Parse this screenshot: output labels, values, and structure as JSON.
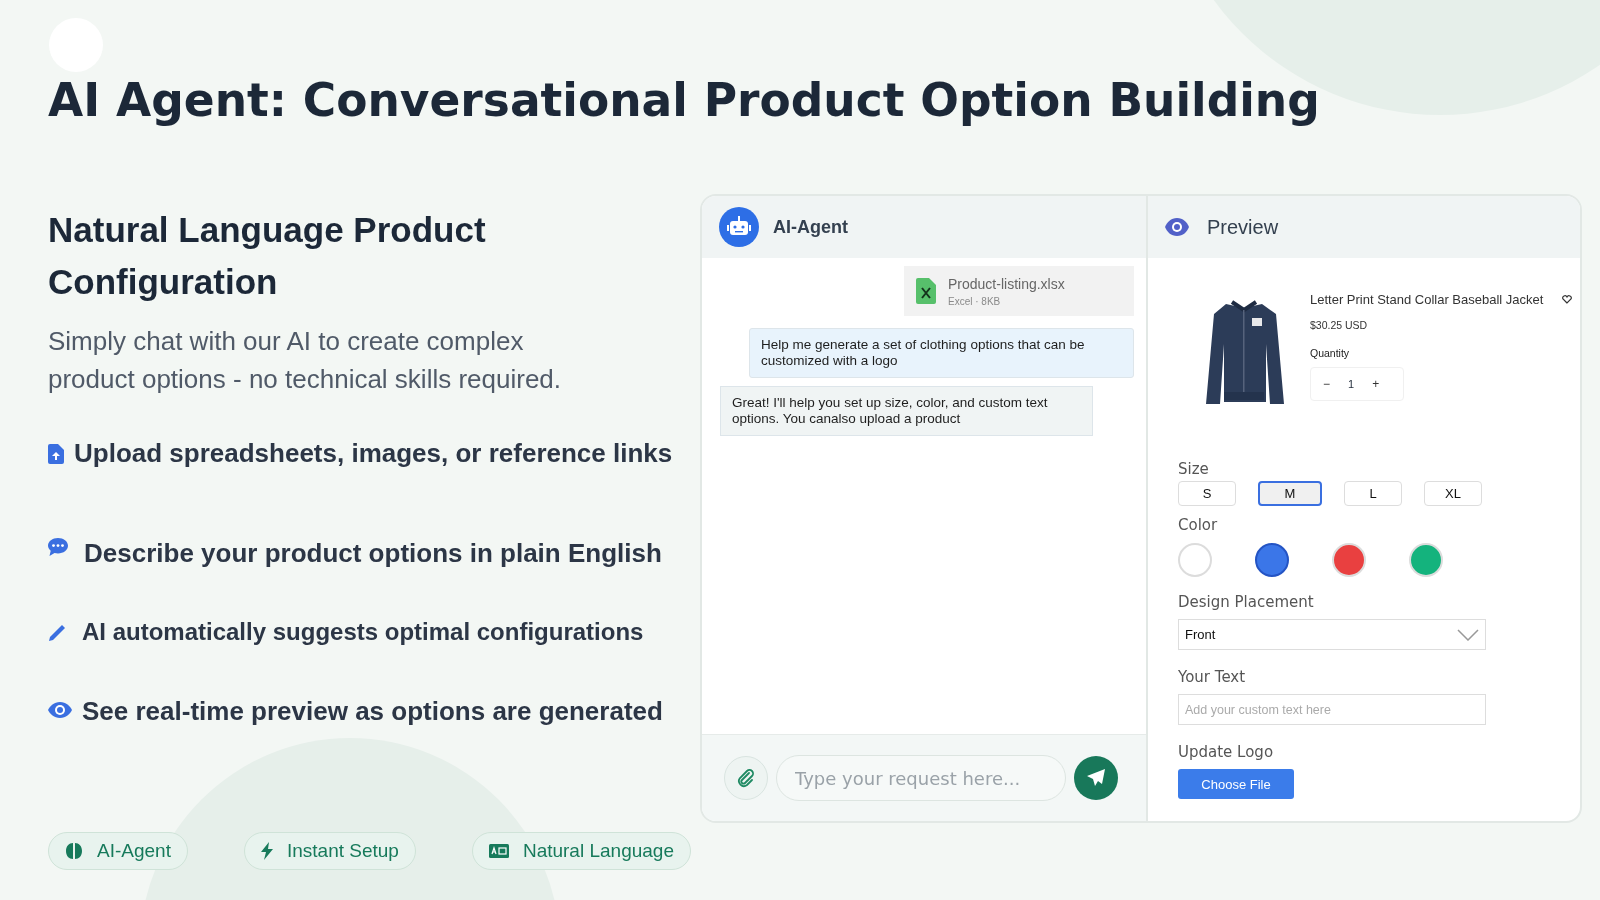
{
  "page": {
    "title": "AI Agent: Conversational Product Option Building"
  },
  "intro": {
    "heading": "Natural Language Product Configuration",
    "description": "Simply chat with our AI to create complex product options - no technical skills required."
  },
  "features": [
    {
      "kind": "upload",
      "text": "Upload spreadsheets, images, or reference links"
    },
    {
      "kind": "chat",
      "text": "Describe your product options in plain English"
    },
    {
      "kind": "pencil",
      "text": "AI automatically suggests optimal configurations"
    },
    {
      "kind": "eye",
      "text": "See real-time preview as options are generated"
    }
  ],
  "badges": [
    {
      "kind": "brain",
      "label": "AI-Agent"
    },
    {
      "kind": "bolt",
      "label": "Instant Setup"
    },
    {
      "kind": "card",
      "label": "Natural Language"
    }
  ],
  "chat": {
    "title": "AI-Agent",
    "attachment": {
      "name": "Product-listing.xlsx",
      "meta": "Excel · 8KB"
    },
    "messages": [
      {
        "kind": "user",
        "text": "Help me generate a set of clothing options that can be customized with a logo"
      },
      {
        "kind": "agent",
        "text": "Great! I'll help you set up size, color, and custom text options. You canalso upload a product"
      }
    ],
    "input": {
      "placeholder": "Type your request here..."
    }
  },
  "preview": {
    "title": "Preview",
    "product": {
      "name": "Letter Print Stand Collar Baseball Jacket",
      "price": "$30.25 USD",
      "quantity_label": "Quantity",
      "decrease": "−",
      "quantity": "1",
      "increase": "+"
    },
    "size": {
      "label": "Size",
      "options": [
        {
          "label": "S",
          "selected": false
        },
        {
          "label": "M",
          "selected": true
        },
        {
          "label": "L",
          "selected": false
        },
        {
          "label": "XL",
          "selected": false
        }
      ]
    },
    "color": {
      "label": "Color",
      "options": [
        {
          "color": "#ffffff",
          "selected": false
        },
        {
          "color": "#3b76e8",
          "selected": true
        },
        {
          "color": "#e94040",
          "selected": false
        },
        {
          "color": "#14b37d",
          "selected": false
        }
      ]
    },
    "placement": {
      "label": "Design Placement",
      "value": "Front"
    },
    "text": {
      "label": "Your Text",
      "placeholder": "Add your custom text here"
    },
    "logo": {
      "label": "Update Logo",
      "button": "Choose File"
    }
  }
}
